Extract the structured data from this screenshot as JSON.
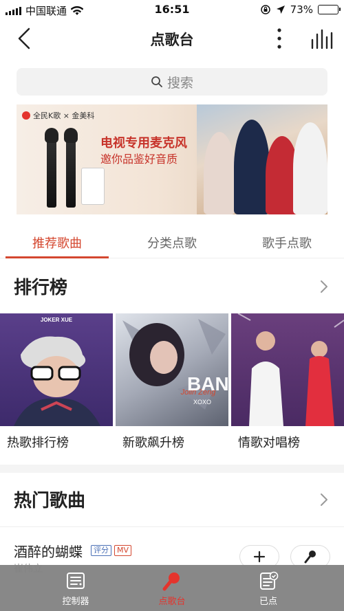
{
  "status_bar": {
    "carrier": "中国联通",
    "time": "16:51",
    "battery": "73%",
    "battery_level": 0.73
  },
  "nav": {
    "title": "点歌台",
    "back_icon": "chevron-left-icon",
    "more_icon": "more-vertical-icon",
    "equalizer_icon": "equalizer-icon"
  },
  "search": {
    "placeholder": "搜索"
  },
  "banner": {
    "brand": "全民K歌 × 金美科",
    "title": "电视专用麦克风",
    "subtitle": "邀你品鉴好音质"
  },
  "tabs": [
    {
      "label": "推荐歌曲",
      "active": true
    },
    {
      "label": "分类点歌",
      "active": false
    },
    {
      "label": "歌手点歌",
      "active": false
    }
  ],
  "ranking": {
    "title": "排行榜",
    "items": [
      {
        "label": "热歌排行榜",
        "cover_text": "JOKER XUE"
      },
      {
        "label": "新歌飙升榜",
        "cover_text": "BAN THE WUR",
        "cover_script": "Jolin Zeng",
        "cover_small": "XOXO"
      },
      {
        "label": "情歌对唱榜"
      }
    ]
  },
  "hot_songs": {
    "title": "热门歌曲",
    "items": [
      {
        "title": "酒醉的蝴蝶",
        "tags": [
          "评分",
          "MV"
        ],
        "artist": "崔伟立"
      }
    ]
  },
  "bottom_bar": [
    {
      "label": "控制器",
      "icon": "controller-icon",
      "active": false
    },
    {
      "label": "点歌台",
      "icon": "song-station-icon",
      "active": true
    },
    {
      "label": "已点",
      "icon": "ordered-list-icon",
      "active": false
    }
  ],
  "colors": {
    "accent": "#d4472f",
    "tag_blue": "#4a6fb5",
    "bottom_bar": "#828282"
  }
}
